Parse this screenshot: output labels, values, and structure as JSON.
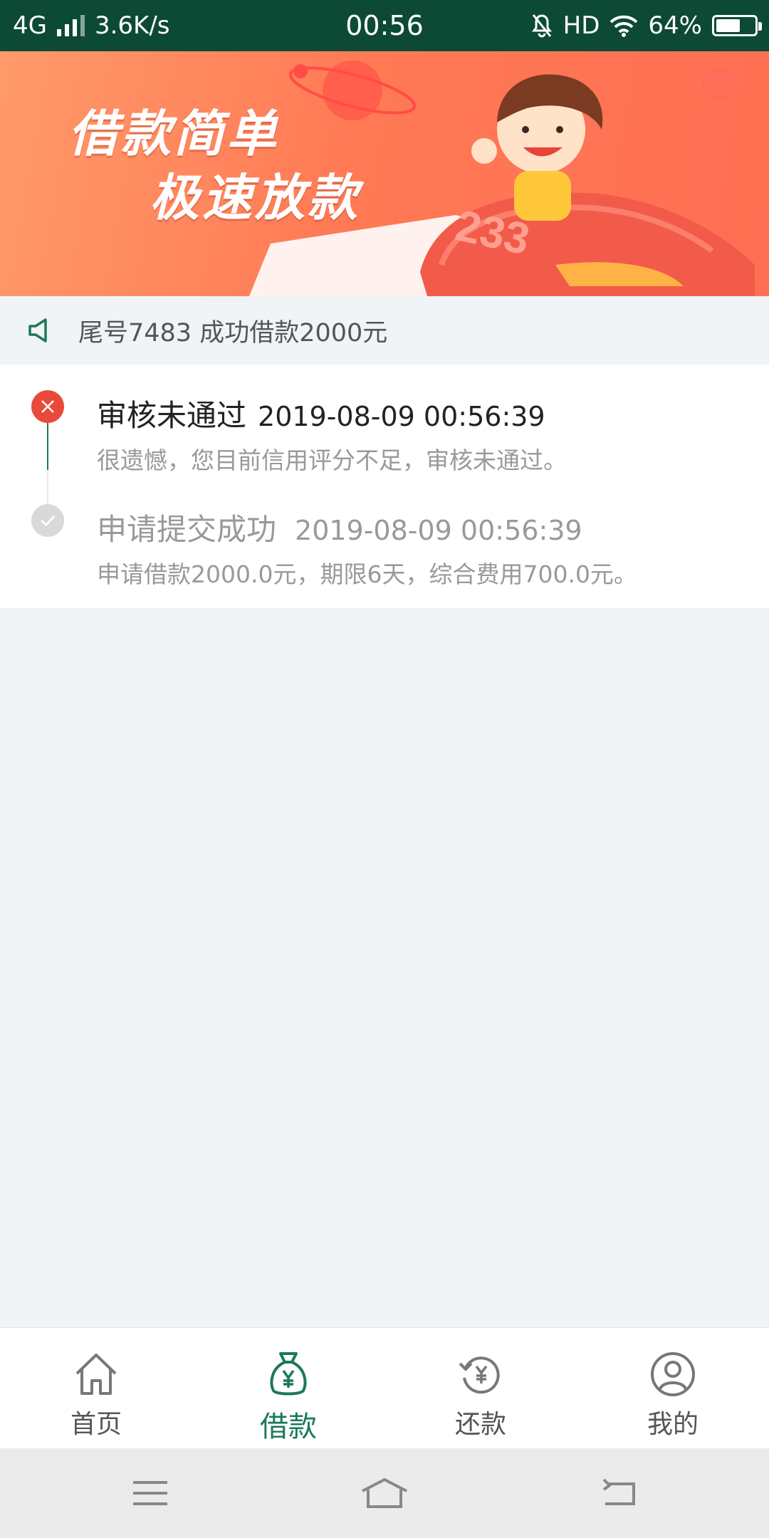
{
  "status_bar": {
    "network": "4G",
    "speed": "3.6K/s",
    "time": "00:56",
    "hd": "HD",
    "battery": "64%",
    "battery_level": 0.64
  },
  "banner": {
    "line1": "借款简单",
    "line2": "极速放款",
    "rocket_number": "233"
  },
  "notice": {
    "text": "尾号7483 成功借款2000元"
  },
  "timeline": [
    {
      "status": "审核未通过",
      "time": "2019-08-09 00:56:39",
      "desc": "很遗憾，您目前信用评分不足，审核未通过。",
      "icon": "close-icon"
    },
    {
      "status": "申请提交成功",
      "time": "2019-08-09 00:56:39",
      "desc": "申请借款2000.0元，期限6天，综合费用700.0元。",
      "icon": "check-icon"
    }
  ],
  "tabs": [
    {
      "label": "首页",
      "icon": "home-icon",
      "active": false
    },
    {
      "label": "借款",
      "icon": "money-bag-icon",
      "active": true
    },
    {
      "label": "还款",
      "icon": "repay-icon",
      "active": false
    },
    {
      "label": "我的",
      "icon": "profile-icon",
      "active": false
    }
  ],
  "colors": {
    "header": "#0d4a35",
    "accent": "#1b7a55",
    "error": "#e9493a",
    "banner": "#ff7a55"
  }
}
